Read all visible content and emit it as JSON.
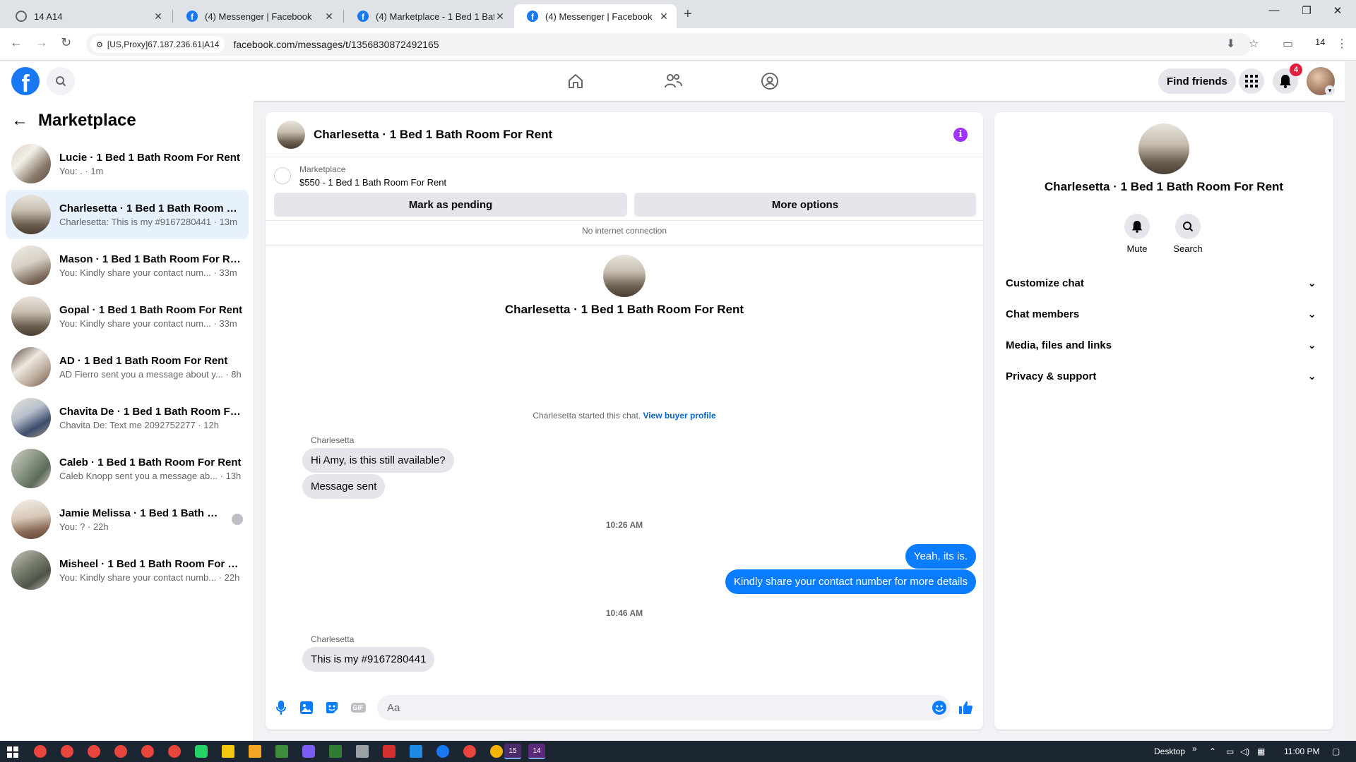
{
  "browser": {
    "tabs": [
      {
        "title": "14 A14",
        "active": false
      },
      {
        "title": "(4) Messenger | Facebook",
        "active": false
      },
      {
        "title": "(4) Marketplace - 1 Bed 1 Bath",
        "active": false
      },
      {
        "title": "(4) Messenger | Facebook",
        "active": true
      }
    ],
    "proxy_chip": "[US,Proxy]67.187.236.61|A14",
    "url": "facebook.com/messages/t/1356830872492165",
    "profile_count": "14"
  },
  "header": {
    "find_friends_label": "Find friends",
    "notification_count": "4"
  },
  "sidebar": {
    "title": "Marketplace",
    "conversations": [
      {
        "name": "Lucie · 1 Bed 1 Bath Room For Rent",
        "snippet": "You: . · 1m",
        "active": false
      },
      {
        "name": "Charlesetta · 1 Bed 1 Bath Room Fo...",
        "snippet": "Charlesetta: This is my #9167280441 · 13m",
        "active": true
      },
      {
        "name": "Mason · 1 Bed 1 Bath Room For Rent",
        "snippet": "You: Kindly share your contact num... · 33m",
        "active": false
      },
      {
        "name": "Gopal · 1 Bed 1 Bath Room For Rent",
        "snippet": "You: Kindly share your contact num... · 33m",
        "active": false
      },
      {
        "name": "AD · 1 Bed 1 Bath Room For Rent",
        "snippet": "AD Fierro sent you a message about y... · 8h",
        "active": false
      },
      {
        "name": "Chavita De · 1 Bed 1 Bath Room Fo...",
        "snippet": "Chavita De: Text me 2092752277 · 12h",
        "active": false
      },
      {
        "name": "Caleb · 1 Bed 1 Bath Room For Rent",
        "snippet": "Caleb Knopp sent you a message ab... · 13h",
        "active": false
      },
      {
        "name": "Jamie Melissa · 1 Bed 1 Bath Roo...",
        "snippet": "You: ? · 22h",
        "active": false
      },
      {
        "name": "Misheel · 1 Bed 1 Bath Room For R...",
        "snippet": "You: Kindly share your contact numb... · 22h",
        "active": false
      }
    ]
  },
  "chat": {
    "title": "Charlesetta · 1 Bed 1 Bath Room For Rent",
    "listing": {
      "label": "Marketplace",
      "price_title": "$550 - 1 Bed 1 Bath Room For Rent",
      "mark_pending_label": "Mark as pending",
      "more_options_label": "More options"
    },
    "connection_status": "No internet connection",
    "intro_name": "Charlesetta · 1 Bed 1 Bath Room For Rent",
    "started_text": "Charlesetta started this chat.",
    "view_profile_link": "View buyer profile",
    "messages": [
      {
        "sender": "Charlesetta",
        "text": "Hi Amy, is this still available?",
        "direction": "in"
      },
      {
        "text": "Message sent",
        "direction": "in"
      },
      {
        "timestamp": "10:26 AM"
      },
      {
        "text": "Yeah, its is.",
        "direction": "out"
      },
      {
        "text": "Kindly share your contact number for more details",
        "direction": "out"
      },
      {
        "timestamp": "10:46 AM"
      },
      {
        "sender": "Charlesetta",
        "text": "This is my #9167280441",
        "direction": "in"
      }
    ],
    "composer_placeholder": "Aa",
    "gif_label": "GIF"
  },
  "info_panel": {
    "name": "Charlesetta · 1 Bed 1 Bath Room For Rent",
    "mute_label": "Mute",
    "search_label": "Search",
    "sections": [
      "Customize chat",
      "Chat members",
      "Media, files and links",
      "Privacy & support"
    ]
  },
  "taskbar": {
    "desktop_label": "Desktop",
    "time": "11:00 PM",
    "badge_a": "15",
    "badge_b": "14"
  },
  "colors": {
    "fb_blue": "#1877f2",
    "outgoing_bubble": "#0a7cff",
    "incoming_bubble": "#e4e6eb",
    "info_purple": "#a033ff",
    "notification_red": "#e41e3f"
  }
}
